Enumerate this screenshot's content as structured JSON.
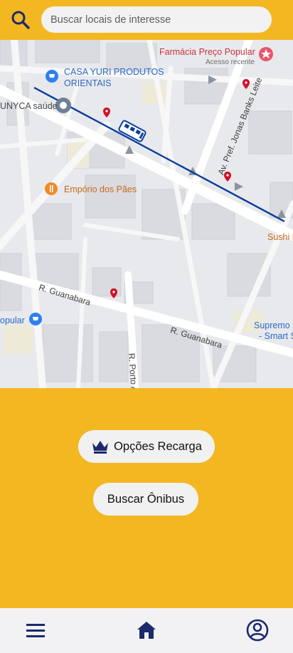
{
  "search": {
    "placeholder": "Buscar locais de interesse"
  },
  "map": {
    "places": {
      "farmacia": "Farmácia Preço Popular",
      "farmacia_sub": "Acesso recente",
      "casa_yuri_1": "CASA YURI PRODUTOS",
      "casa_yuri_2": "ORIENTAIS",
      "unyca": "UNYCA saúde",
      "emporio": "Empório dos Pães",
      "sushi": "Sushi F",
      "popular": "opular",
      "supremo_1": "Supremo S",
      "supremo_2": "- Smart S"
    },
    "streets": {
      "jonas": "Av. Pref. Jonas Banks Leite",
      "guanabara_1": "R. Guanabara",
      "guanabara_2": "R. Guanabara",
      "porto": "R. Porto Al"
    }
  },
  "actions": {
    "recharge_label": "Opções Recarga",
    "bus_label": "Buscar Ônibus"
  },
  "colors": {
    "brand_yellow": "#F3B722",
    "route_blue": "#0A3C9C",
    "nav_icon": "#1A2A6B"
  },
  "icons": {
    "search": "search-icon",
    "crown": "crown-icon",
    "menu": "menu-icon",
    "home": "home-icon",
    "profile": "profile-icon"
  }
}
